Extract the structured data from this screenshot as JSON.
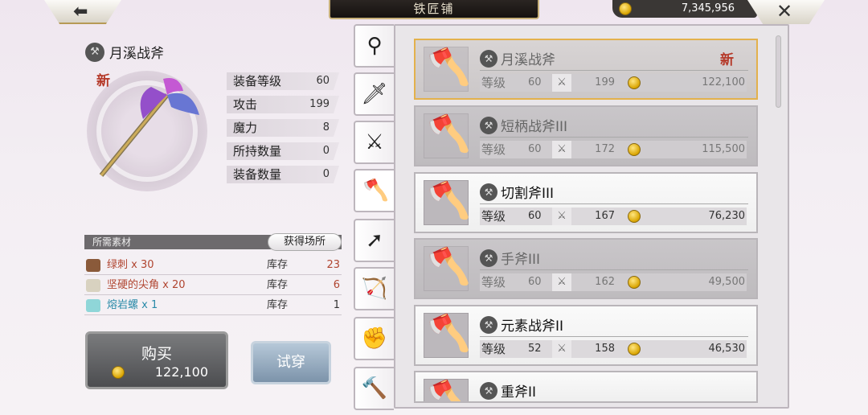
{
  "header": {
    "title": "铁匠铺",
    "money": "7,345,956"
  },
  "detail": {
    "name": "月溪战斧",
    "new_tag": "新",
    "stats": [
      {
        "label": "装备等级",
        "value": "60"
      },
      {
        "label": "攻击",
        "value": "199"
      },
      {
        "label": "魔力",
        "value": "8"
      },
      {
        "label": "所持数量",
        "value": "0"
      },
      {
        "label": "装备数量",
        "value": "0"
      }
    ]
  },
  "materials": {
    "header": "所需素材",
    "source_button": "获得场所",
    "items": [
      {
        "name": "绿刺 x 30",
        "stock_label": "库存",
        "count": "23",
        "color": "#b04530"
      },
      {
        "name": "坚硬的尖角 x 20",
        "stock_label": "库存",
        "count": "6",
        "color": "#b04530"
      },
      {
        "name": "熔岩螺 x 1",
        "stock_label": "库存",
        "count": "1",
        "color": "#2a8aa8"
      }
    ]
  },
  "buy": {
    "label": "购买",
    "price": "122,100"
  },
  "try_on": {
    "label": "试穿"
  },
  "tabs": [
    "staff-icon",
    "sword-icon",
    "curved-blade-icon",
    "axe-icon",
    "spear-icon",
    "bow-icon",
    "fist-icon",
    "hammer-icon"
  ],
  "list": [
    {
      "name": "月溪战斧",
      "level_label": "等级",
      "level": "60",
      "attack": "199",
      "price": "122,100",
      "new": "新"
    },
    {
      "name": "短柄战斧III",
      "level_label": "等级",
      "level": "60",
      "attack": "172",
      "price": "115,500"
    },
    {
      "name": "切割斧III",
      "level_label": "等级",
      "level": "60",
      "attack": "167",
      "price": "76,230"
    },
    {
      "name": "手斧III",
      "level_label": "等级",
      "level": "60",
      "attack": "162",
      "price": "49,500"
    },
    {
      "name": "元素战斧II",
      "level_label": "等级",
      "level": "52",
      "attack": "158",
      "price": "46,530"
    },
    {
      "name": "重斧II"
    }
  ]
}
